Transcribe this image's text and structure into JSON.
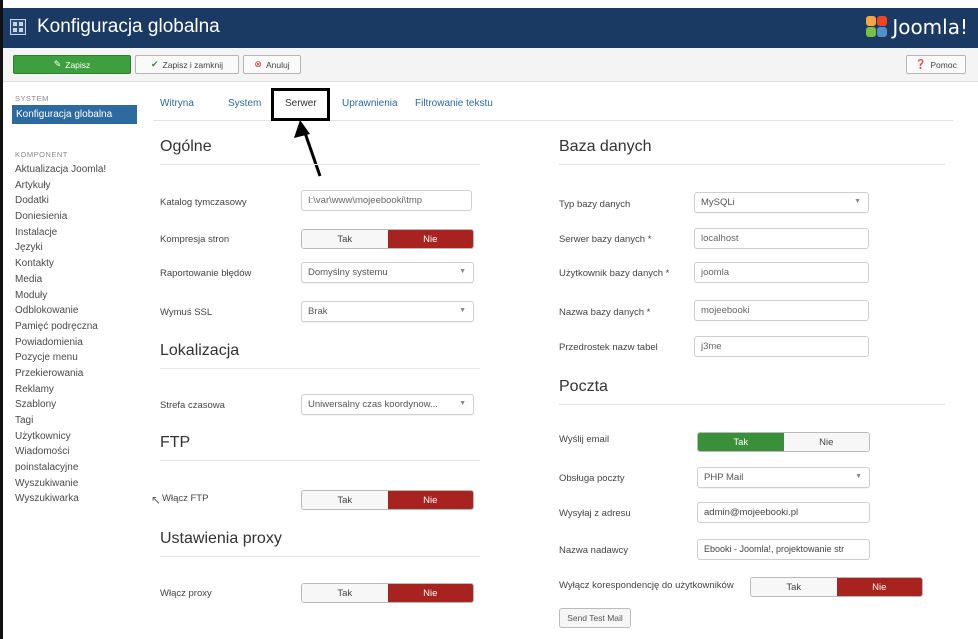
{
  "header": {
    "title": "Konfiguracja globalna",
    "logo_text": "Joomla!"
  },
  "toolbar": {
    "save": "Zapisz",
    "save_close": "Zapisz i zamknij",
    "cancel": "Anuluj",
    "help": "Pomoc"
  },
  "sidebar": {
    "system_heading": "SYSTEM",
    "active_item": "Konfiguracja globalna",
    "component_heading": "KOMPONENT",
    "items": [
      "Aktualizacja Joomla!",
      "Artykuły",
      "Dodatki",
      "Doniesienia",
      "Instalacje",
      "Języki",
      "Kontakty",
      "Media",
      "Moduły",
      "Odblokowanie",
      "Pamięć podręczna",
      "Powiadomienia",
      "Pozycje menu",
      "Przekierowania",
      "Reklamy",
      "Szablony",
      "Tagi",
      "Użytkownicy",
      "Wiadomości",
      "poinstalacyjne",
      "Wyszukiwanie",
      "Wyszukiwarka"
    ]
  },
  "tabs": [
    "Witryna",
    "System",
    "Serwer",
    "Uprawnienia",
    "Filtrowanie tekstu"
  ],
  "general": {
    "heading": "Ogólne",
    "temp_dir_label": "Katalog tymczasowy",
    "temp_dir_value": "I:\\var\\www\\mojeebooki\\tmp",
    "compression_label": "Kompresja stron",
    "error_report_label": "Raportowanie błędów",
    "error_report_value": "Domyślny systemu",
    "ssl_label": "Wymuś SSL",
    "ssl_value": "Brak"
  },
  "locale": {
    "heading": "Lokalizacja",
    "timezone_label": "Strefa czasowa",
    "timezone_value": "Uniwersalny czas koordynow..."
  },
  "ftp": {
    "heading": "FTP",
    "enable_label": "Włącz FTP"
  },
  "proxy": {
    "heading": "Ustawienia proxy",
    "enable_label": "Włącz proxy"
  },
  "database": {
    "heading": "Baza danych",
    "type_label": "Typ bazy danych",
    "type_value": "MySQLi",
    "server_label": "Serwer bazy danych *",
    "server_value": "localhost",
    "user_label": "Użytkownik bazy danych *",
    "user_value": "joomla",
    "name_label": "Nazwa bazy danych *",
    "name_value": "mojeebooki",
    "prefix_label": "Przedrostek nazw tabel",
    "prefix_value": "j3me"
  },
  "mail": {
    "heading": "Poczta",
    "send_label": "Wyślij email",
    "mailer_label": "Obsługa poczty",
    "mailer_value": "PHP Mail",
    "from_label": "Wysyłaj z adresu",
    "from_value": "admin@mojeebooki.pl",
    "sender_label": "Nazwa nadawcy",
    "sender_value": "Ebooki - Joomla!, projektowanie str",
    "disable_label": "Wyłącz korespondencję do użytkowników",
    "test_button": "Send Test Mail"
  },
  "toggle": {
    "yes": "Tak",
    "no": "Nie"
  },
  "colors": {
    "header_bg": "#1b3a63",
    "accent_blue": "#2d6aa0",
    "no_red": "#a8221f",
    "yes_green": "#3a8f3a"
  }
}
